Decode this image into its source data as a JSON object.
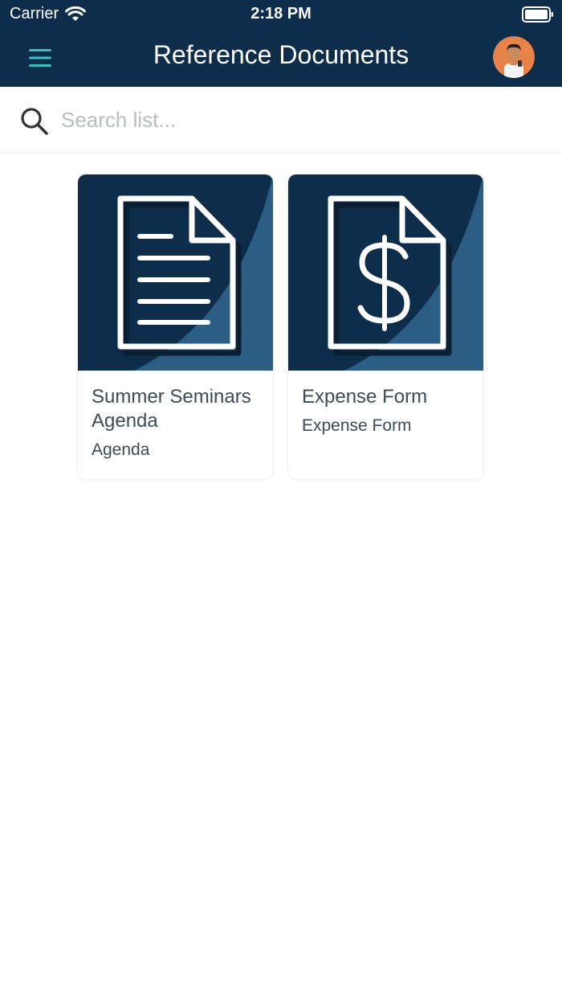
{
  "status_bar": {
    "carrier": "Carrier",
    "time": "2:18 PM"
  },
  "navbar": {
    "title": "Reference Documents",
    "menu_icon": "hamburger-menu-icon",
    "avatar": "user-avatar"
  },
  "search": {
    "placeholder": "Search list...",
    "value": ""
  },
  "documents": [
    {
      "title": "Summer Seminars Agenda",
      "subtitle": "Agenda",
      "icon": "document-lines-icon"
    },
    {
      "title": "Expense Form",
      "subtitle": "Expense Form",
      "icon": "dollar-document-icon"
    }
  ],
  "colors": {
    "header": "#0d2d4a",
    "thumb_dark": "#0d2d4a",
    "thumb_light": "#2b5d85",
    "menu_accent": "#3fbfc1",
    "text": "#3d4a55"
  }
}
